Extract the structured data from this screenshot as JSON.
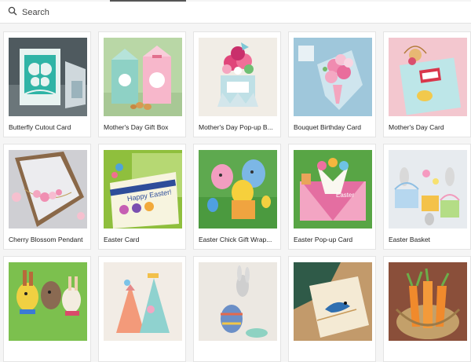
{
  "search": {
    "placeholder": "Search",
    "icon": "search-icon"
  },
  "cards": [
    {
      "label": "Butterfly Cutout Card"
    },
    {
      "label": "Mother's Day Gift Box"
    },
    {
      "label": "Mother's Day Pop-up B..."
    },
    {
      "label": "Bouquet Birthday Card"
    },
    {
      "label": "Mother's Day Card"
    },
    {
      "label": "Cherry Blossom Pendant"
    },
    {
      "label": "Easter Card"
    },
    {
      "label": "Easter Chick Gift Wrap..."
    },
    {
      "label": "Easter Pop-up Card"
    },
    {
      "label": "Easter Basket"
    },
    {
      "label": ""
    },
    {
      "label": ""
    },
    {
      "label": ""
    },
    {
      "label": ""
    },
    {
      "label": ""
    }
  ],
  "easter_card_text": "Happy Easter!",
  "easter_popup_text": "Easter"
}
